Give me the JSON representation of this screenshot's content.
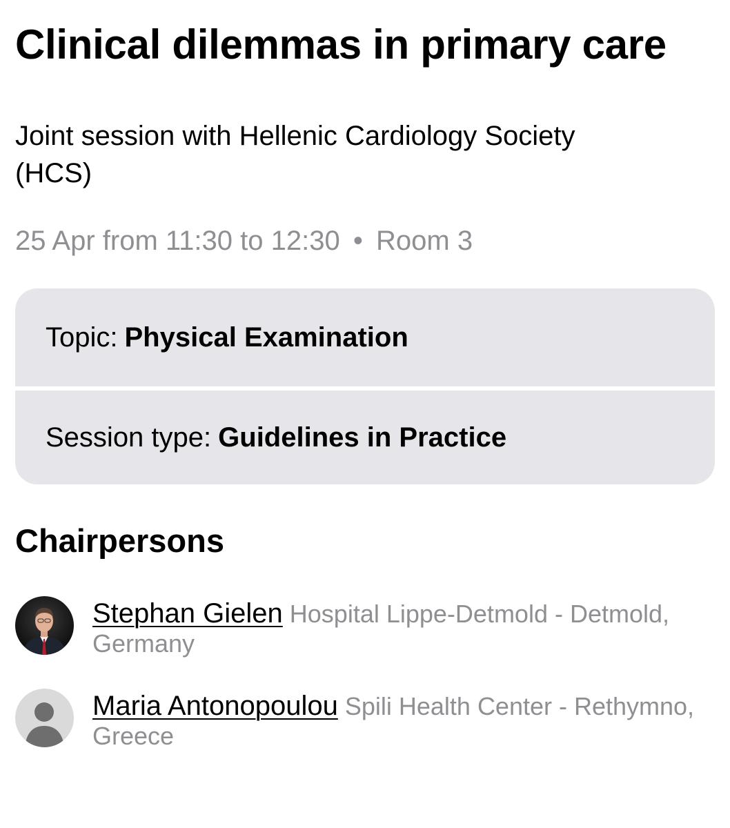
{
  "session": {
    "title": "Clinical dilemmas in primary care",
    "subtitle": "Joint session with Hellenic Cardiology Society (HCS)",
    "date": "25 Apr",
    "time_from_label": "from",
    "time_start": "11:30",
    "time_to_label": "to",
    "time_end": "12:30",
    "separator": "•",
    "room": "Room 3"
  },
  "info": {
    "topic_label": "Topic:",
    "topic_value": "Physical Examination",
    "session_type_label": "Session type:",
    "session_type_value": "Guidelines in Practice"
  },
  "chairpersons": {
    "heading": "Chairpersons",
    "people": [
      {
        "name": "Stephan Gielen",
        "affiliation": "Hospital Lippe-Detmold - Detmold, Germany",
        "avatar": "photo-avatar"
      },
      {
        "name": "Maria Antonopoulou",
        "affiliation": "Spili Health Center - Rethymno, Greece",
        "avatar": "placeholder-person-icon"
      }
    ]
  }
}
